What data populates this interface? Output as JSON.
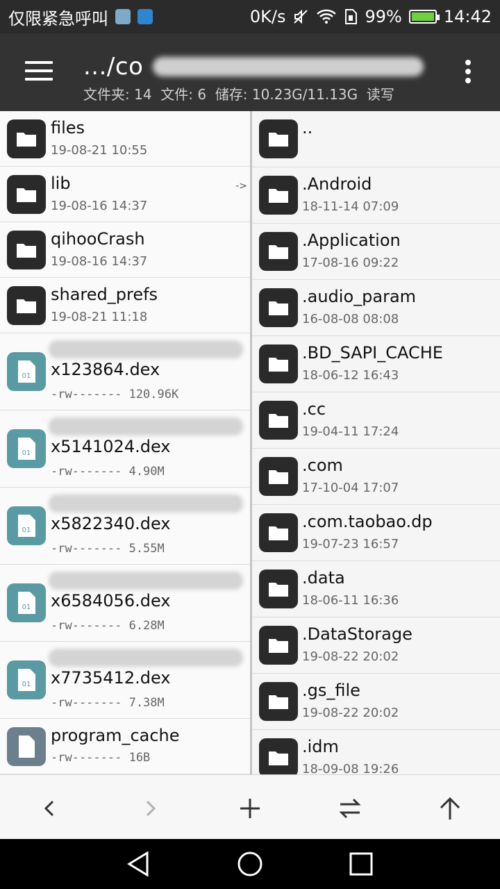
{
  "status_bar": {
    "left_text": "仅限紧急呼叫",
    "speed": "0K/s",
    "battery_pct": "99%",
    "time": "14:42"
  },
  "app_bar": {
    "path": ".../co",
    "folders_label": "文件夹: 14",
    "files_label": "文件: 6",
    "storage_label": "储存: 10.23G/11.13G",
    "mode_label": "读写"
  },
  "left_pane": {
    "items": [
      {
        "name": "files",
        "meta": "19-08-21 10:55",
        "kind": "folder"
      },
      {
        "name": "lib",
        "meta": "19-08-16 14:37",
        "kind": "folder",
        "link": "->"
      },
      {
        "name": "qihooCrash",
        "meta": "19-08-16 14:37",
        "kind": "folder"
      },
      {
        "name": "shared_prefs",
        "meta": "19-08-21 11:18",
        "kind": "folder"
      },
      {
        "name": "x123864.dex",
        "meta": "-rw------- 120.96K",
        "kind": "dex"
      },
      {
        "name": "x5141024.dex",
        "meta": "-rw-------   4.90M",
        "kind": "dex"
      },
      {
        "name": "x5822340.dex",
        "meta": "-rw-------   5.55M",
        "kind": "dex"
      },
      {
        "name": "x6584056.dex",
        "meta": "-rw-------   6.28M",
        "kind": "dex"
      },
      {
        "name": "x7735412.dex",
        "meta": "-rw-------   7.38M",
        "kind": "dex"
      },
      {
        "name": "program_cache",
        "meta": "-rw-------   16B",
        "kind": "doc"
      }
    ]
  },
  "right_pane": {
    "items": [
      {
        "name": "..",
        "meta": ""
      },
      {
        "name": ".Android",
        "meta": "18-11-14 07:09"
      },
      {
        "name": ".Application",
        "meta": "17-08-16 09:22"
      },
      {
        "name": ".audio_param",
        "meta": "16-08-08 08:08"
      },
      {
        "name": ".BD_SAPI_CACHE",
        "meta": "18-06-12 16:43"
      },
      {
        "name": ".cc",
        "meta": "19-04-11 17:24"
      },
      {
        "name": ".com",
        "meta": "17-10-04 17:07"
      },
      {
        "name": ".com.taobao.dp",
        "meta": "19-07-23 16:57"
      },
      {
        "name": ".data",
        "meta": "18-06-11 16:36"
      },
      {
        "name": ".DataStorage",
        "meta": "19-08-22 20:02"
      },
      {
        "name": ".gs_file",
        "meta": "19-08-22 20:02"
      },
      {
        "name": ".idm",
        "meta": "18-09-08 19:26"
      }
    ]
  },
  "dex_icon_label": "01",
  "colors": {
    "app_bar": "#333333",
    "folder_icon": "#2a2a2a",
    "dex_icon": "#5a9aa2",
    "doc_icon": "#6b7f8c"
  }
}
